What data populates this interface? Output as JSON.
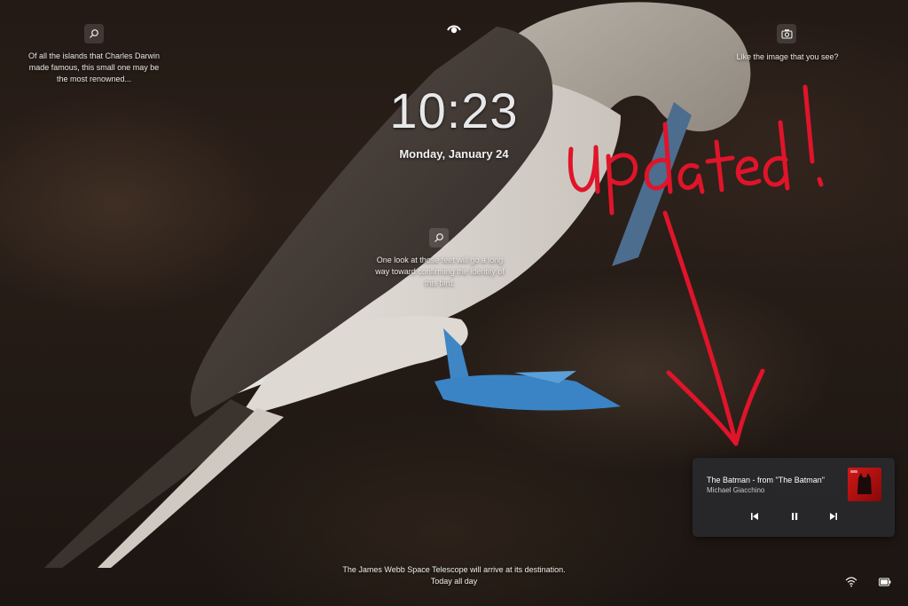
{
  "lockscreen": {
    "time": "10:23",
    "date": "Monday, January 24"
  },
  "spotlight": {
    "top_left_caption_line1": "Of all the islands that Charles Darwin",
    "top_left_caption_line2": "made famous, this small one may be",
    "top_left_caption_line3": "the most renowned...",
    "center_caption_line1": "One look at those feet will go a long",
    "center_caption_line2": "way toward confirming the identity of",
    "center_caption_line3": "this bird.",
    "top_right_caption": "Like the image that you see?"
  },
  "annotation": {
    "text": "updated !",
    "color": "#e0142a"
  },
  "media": {
    "title": "The Batman - from \"The Batman\"",
    "artist": "Michael Giacchino"
  },
  "footer": {
    "line1": "The James Webb Space Telescope will arrive at its destination.",
    "line2": "Today all day"
  },
  "icons": {
    "search": "search-icon",
    "camera": "camera-icon",
    "eye": "eye-icon",
    "wifi": "wifi-icon",
    "battery": "battery-icon"
  }
}
